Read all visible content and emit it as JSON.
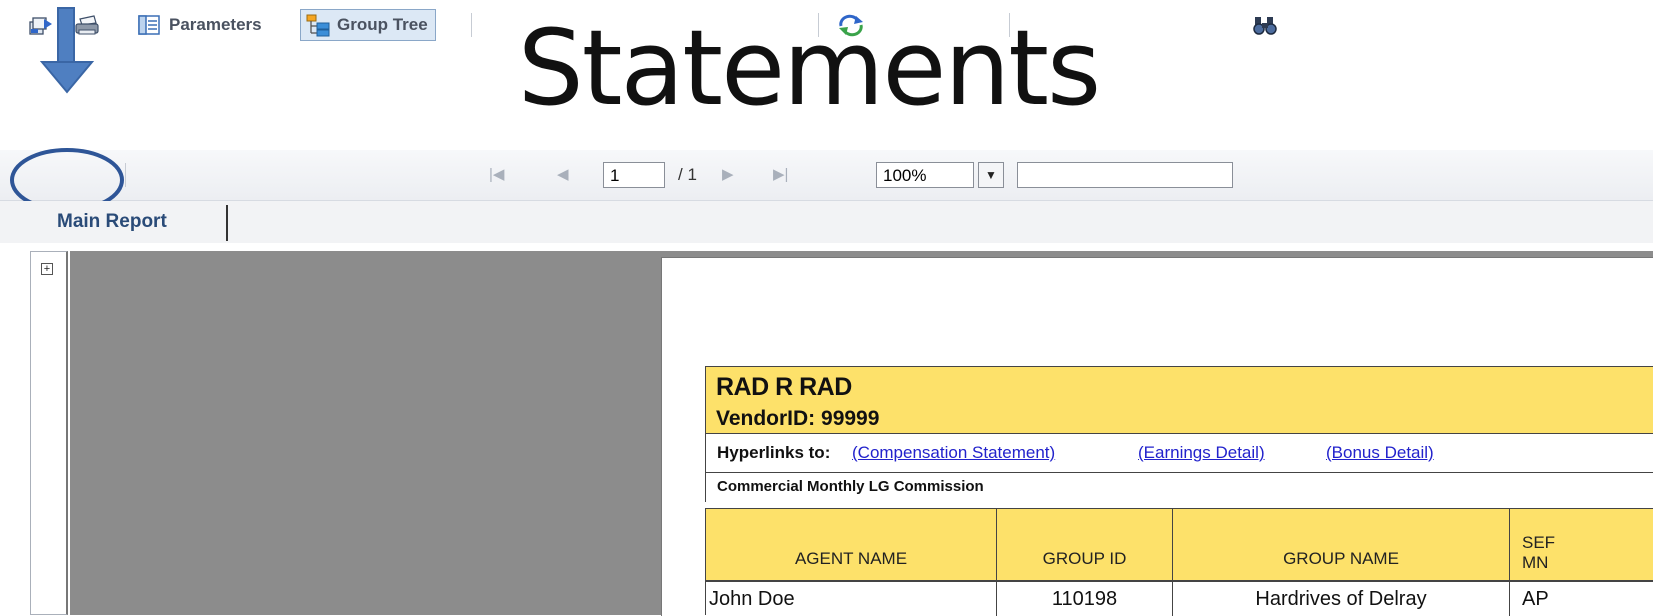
{
  "title": "Statements",
  "toolbar": {
    "parameters_label": "Parameters",
    "group_tree_label": "Group Tree",
    "page_value": "1",
    "page_total": "/ 1",
    "zoom_value": "100%",
    "search_value": ""
  },
  "tabs": {
    "main_report": "Main Report"
  },
  "tree": {
    "expand_symbol": "+"
  },
  "report": {
    "name": "RAD R RAD",
    "vendor": "VendorID: 99999",
    "links_label": "Hyperlinks to:",
    "links": [
      "(Compensation Statement)",
      "(Earnings Detail)",
      "(Bonus Detail)"
    ],
    "section_title": "Commercial Monthly LG Commission",
    "columns": [
      "AGENT NAME",
      "GROUP ID",
      "GROUP NAME",
      "SEF MN"
    ],
    "columns_partial": [
      "SEF",
      "MN"
    ],
    "rows": [
      {
        "agent_name": "John Doe",
        "group_id": "110198",
        "group_name": "Hardrives of Delray",
        "service_month": "AP"
      }
    ]
  },
  "colors": {
    "highlight": "#fde16a",
    "link": "#2222cc",
    "annotation": "#2e5597",
    "arrow": "#4f7fc1"
  }
}
